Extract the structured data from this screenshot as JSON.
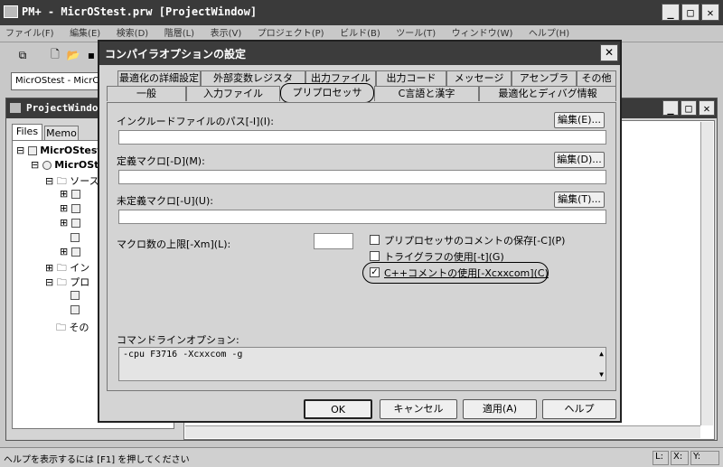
{
  "app": {
    "title": "PM+ - MicrOStest.prw [ProjectWindow]",
    "menu": [
      "ファイル(F)",
      "編集(E)",
      "検索(D)",
      "階層(L)",
      "表示(V)",
      "プロジェクト(P)",
      "ビルド(B)",
      "ツール(T)",
      "ウィンドウ(W)",
      "ヘルプ(H)"
    ],
    "project_combo": "MicrOStest - MicrOS",
    "status_text": "ヘルプを表示するには [F1] を押してください",
    "status_fields": [
      "L:",
      "X:",
      "Y:"
    ]
  },
  "project_window": {
    "title": "ProjectWindow",
    "tabs": [
      "Files",
      "Memo"
    ],
    "tree": [
      "MicrOStest",
      "MicrOSt",
      "ソース",
      "イン",
      "プロ",
      "その"
    ]
  },
  "dialog": {
    "title": "コンパイラオプションの設定",
    "tabs_row1": [
      "最適化の詳細設定",
      "外部変数レジスタ",
      "出力ファイル",
      "出力コード",
      "メッセージ",
      "アセンブラ",
      "その他"
    ],
    "tabs_row2": [
      "一般",
      "入力ファイル",
      "プリプロセッサ",
      "C言語と漢字",
      "最適化とディバグ情報"
    ],
    "include_label": "インクルードファイルのパス[-I](I):",
    "include_value": "",
    "define_label": "定義マクロ[-D](M):",
    "define_value": "",
    "undef_label": "未定義マクロ[-U](U):",
    "undef_value": "",
    "edit_buttons": [
      "編集(E)...",
      "編集(D)...",
      "編集(T)..."
    ],
    "macro_limit_label": "マクロ数の上限[-Xm](L):",
    "macro_limit_value": "",
    "options": [
      {
        "label": "プリプロセッサのコメントの保存[-C](P)",
        "checked": false
      },
      {
        "label": "トライグラフの使用[-t](G)",
        "checked": false
      },
      {
        "label": "C++コメントの使用[-Xcxxcom](C)",
        "checked": true
      }
    ],
    "cmdline_label": "コマンドラインオプション:",
    "cmdline_value": "-cpu F3716 -Xcxxcom -g",
    "buttons": {
      "ok": "OK",
      "cancel": "キャンセル",
      "apply": "適用(A)",
      "help": "ヘルプ"
    },
    "close_glyph": "✕"
  }
}
